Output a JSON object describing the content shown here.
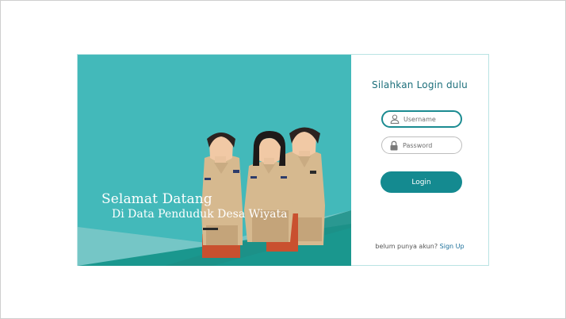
{
  "hero": {
    "welcome_title": "Selamat Datang",
    "welcome_subtitle": "Di Data Penduduk Desa Wiyata",
    "background_color": "#43b9ba"
  },
  "login": {
    "heading": "Silahkan Login dulu",
    "username_placeholder": "Username",
    "username_icon": "user-icon",
    "password_placeholder": "Password",
    "password_icon": "lock-icon",
    "login_button_label": "Login",
    "button_color": "#148a90",
    "signup_prompt": "belum punya akun?",
    "signup_link_label": "Sign Up"
  }
}
